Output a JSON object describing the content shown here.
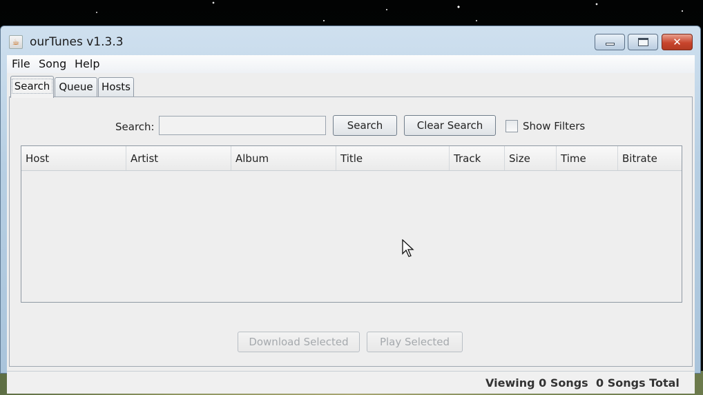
{
  "window": {
    "title": "ourTunes v1.3.3"
  },
  "menu": [
    "File",
    "Song",
    "Help"
  ],
  "tabs": [
    "Search",
    "Queue",
    "Hosts"
  ],
  "search": {
    "label": "Search:",
    "value": "",
    "placeholder": ""
  },
  "buttons": {
    "search": "Search",
    "clear_search": "Clear Search",
    "download_selected": "Download Selected",
    "play_selected": "Play Selected"
  },
  "filters": {
    "label": "Show Filters",
    "checked": false
  },
  "table": {
    "columns": [
      "Host",
      "Artist",
      "Album",
      "Title",
      "Track",
      "Size",
      "Time",
      "Bitrate"
    ],
    "rows": []
  },
  "status": {
    "viewing": "Viewing 0 Songs",
    "total": "0 Songs Total"
  }
}
